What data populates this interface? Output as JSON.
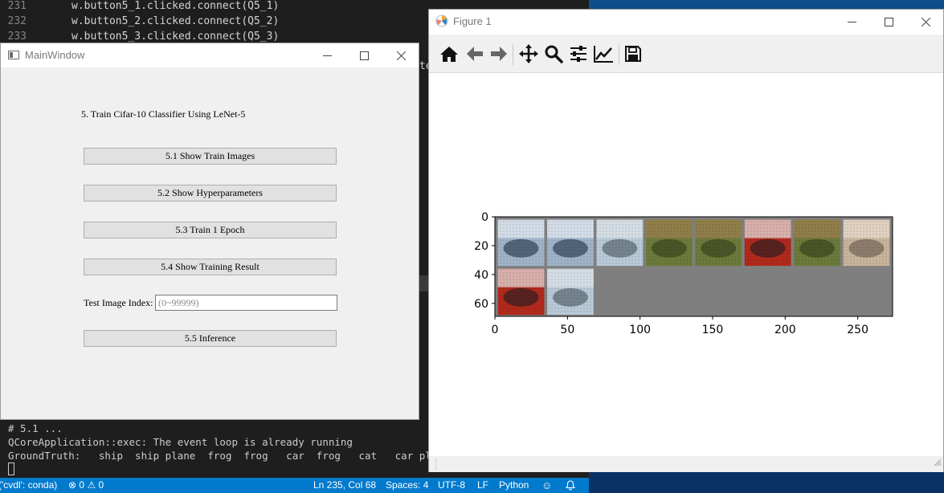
{
  "editor": {
    "lines": [
      {
        "num": "231",
        "code": "w.button5_1.clicked.connect(Q5_1)"
      },
      {
        "num": "232",
        "code": "w.button5_2.clicked.connect(Q5_2)"
      },
      {
        "num": "233",
        "code": "w.button5_3.clicked.connect(Q5_3)"
      }
    ],
    "hidden_fragment": "te"
  },
  "terminal": {
    "lines": [
      "# 5.1 ...",
      "QCoreApplication::exec: The event loop is already running",
      "GroundTruth:   ship  ship plane  frog  frog   car  frog   cat   car plane"
    ]
  },
  "statusbar": {
    "env": "('cvdl': conda)",
    "errors": "0",
    "warnings": "0",
    "position": "Ln 235, Col 68",
    "spaces": "Spaces: 4",
    "encoding": "UTF-8",
    "eol": "LF",
    "language": "Python"
  },
  "mainwindow": {
    "title": "MainWindow",
    "heading": "5. Train Cifar-10 Classifier Using LeNet-5",
    "buttons": {
      "b1": "5.1 Show Train Images",
      "b2": "5.2 Show Hyperparameters",
      "b3": "5.3 Train 1 Epoch",
      "b4": "5.4 Show Training Result",
      "b5": "5.5 Inference"
    },
    "test_index_label": "Test Image Index:",
    "test_index_placeholder": "(0~99999)",
    "test_index_value": ""
  },
  "figure": {
    "title": "Figure 1",
    "toolbar": [
      "home-icon",
      "back-icon",
      "forward-icon",
      "pan-icon",
      "zoom-icon",
      "configure-subplots-icon",
      "edit-axes-icon",
      "save-icon"
    ],
    "xticks": [
      "0",
      "50",
      "100",
      "150",
      "200",
      "250"
    ],
    "yticks": [
      "0",
      "20",
      "40",
      "60"
    ],
    "images": [
      "ship",
      "ship",
      "plane",
      "frog",
      "frog",
      "car",
      "frog",
      "cat",
      "car",
      "plane"
    ]
  },
  "colors": {
    "statusbar": "#007acc",
    "editor_bg": "#1e1e1e",
    "qt_bg": "#f0f0f0",
    "grid_fill": "#808080"
  }
}
